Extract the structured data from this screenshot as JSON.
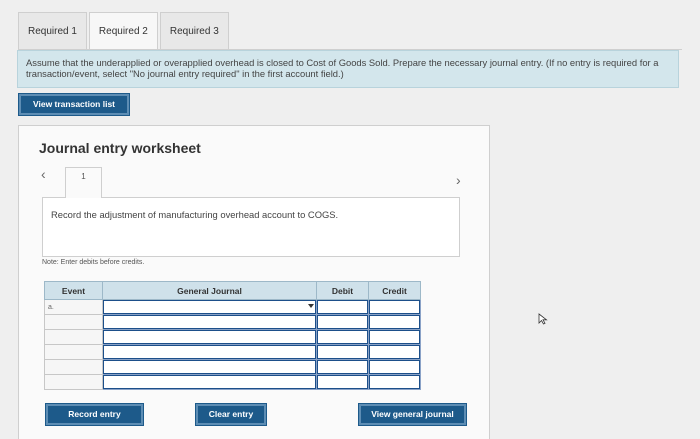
{
  "tabs": [
    {
      "label": "Required 1"
    },
    {
      "label": "Required 2"
    },
    {
      "label": "Required 3"
    }
  ],
  "active_tab": "Required 2",
  "instructions": "Assume that the underapplied or overapplied overhead is closed to Cost of Goods Sold. Prepare the necessary journal entry. (If no entry is required for a transaction/event, select \"No journal entry required\" in the first account field.)",
  "view_transaction_label": "View transaction list",
  "worksheet": {
    "title": "Journal entry worksheet",
    "prev_icon": "chevron-left-icon",
    "next_icon": "chevron-right-icon",
    "page_number": "1",
    "record_text": "Record the adjustment of manufacturing overhead account to COGS.",
    "note": "Note: Enter debits before credits.",
    "columns": {
      "event": "Event",
      "account": "General Journal",
      "debit": "Debit",
      "credit": "Credit"
    },
    "rows": [
      {
        "event": "a.",
        "account": "",
        "debit": "",
        "credit": ""
      },
      {
        "event": "",
        "account": "",
        "debit": "",
        "credit": ""
      },
      {
        "event": "",
        "account": "",
        "debit": "",
        "credit": ""
      },
      {
        "event": "",
        "account": "",
        "debit": "",
        "credit": ""
      },
      {
        "event": "",
        "account": "",
        "debit": "",
        "credit": ""
      },
      {
        "event": "",
        "account": "",
        "debit": "",
        "credit": ""
      }
    ],
    "buttons": {
      "record": "Record entry",
      "clear": "Clear entry",
      "view_general": "View general journal"
    }
  },
  "colors": {
    "button": "#1d5a8a",
    "instruction_bg": "#d3e6ec",
    "table_header": "#cfe1ea"
  }
}
